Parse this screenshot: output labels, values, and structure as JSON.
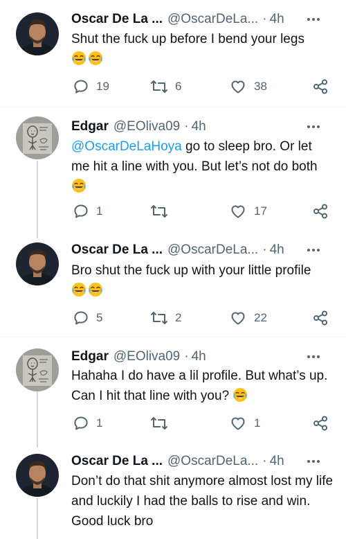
{
  "tweets": [
    {
      "name": "Oscar De La ...",
      "handle": "@OscarDeLa...",
      "time": "4h",
      "avatar_icon": "avatar-oscar",
      "text_parts": [
        {
          "type": "text",
          "value": "Shut the fuck up before I bend your legs"
        },
        {
          "type": "br"
        },
        {
          "type": "emoji",
          "value": "😂"
        },
        {
          "type": "emoji",
          "value": "😂"
        }
      ],
      "replies": "19",
      "retweets": "6",
      "likes": "38"
    },
    {
      "name": "Edgar",
      "handle": "@EOliva09",
      "time": "4h",
      "avatar_icon": "avatar-sketch",
      "text_parts": [
        {
          "type": "mention",
          "value": "@OscarDeLaHoya"
        },
        {
          "type": "text",
          "value": " go to sleep bro. Or let me hit a line with you. But let’s not do both "
        },
        {
          "type": "emoji",
          "value": "😂"
        }
      ],
      "replies": "1",
      "retweets": "",
      "likes": "17"
    },
    {
      "name": "Oscar De La ...",
      "handle": "@OscarDeLa...",
      "time": "4h",
      "avatar_icon": "avatar-oscar",
      "text_parts": [
        {
          "type": "text",
          "value": "Bro shut the fuck up with your little profile"
        },
        {
          "type": "br"
        },
        {
          "type": "emoji",
          "value": "😂"
        },
        {
          "type": "emoji",
          "value": "😂"
        }
      ],
      "replies": "5",
      "retweets": "2",
      "likes": "22"
    },
    {
      "name": "Edgar",
      "handle": "@EOliva09",
      "time": "4h",
      "avatar_icon": "avatar-sketch",
      "text_parts": [
        {
          "type": "text",
          "value": "Hahaha I do have a lil profile. But what’s up. Can I hit that line with you? "
        },
        {
          "type": "emoji",
          "value": "😂"
        }
      ],
      "replies": "1",
      "retweets": "",
      "likes": "1"
    },
    {
      "name": "Oscar De La ...",
      "handle": "@OscarDeLa...",
      "time": "4h",
      "avatar_icon": "avatar-oscar",
      "text_parts": [
        {
          "type": "text",
          "value": "Don’t do that shit anymore almost lost my life and luckily I had the balls to rise and win. Good luck bro"
        }
      ],
      "replies": "",
      "retweets": "",
      "likes": ""
    }
  ],
  "icons": {
    "reply": "reply-icon",
    "retweet": "retweet-icon",
    "like": "heart-icon",
    "share": "share-icon",
    "more": "more-icon"
  },
  "colors": {
    "text": "#0f1419",
    "secondary": "#536471",
    "mention": "#1d9bf0",
    "thread_line": "#cfd9de"
  }
}
